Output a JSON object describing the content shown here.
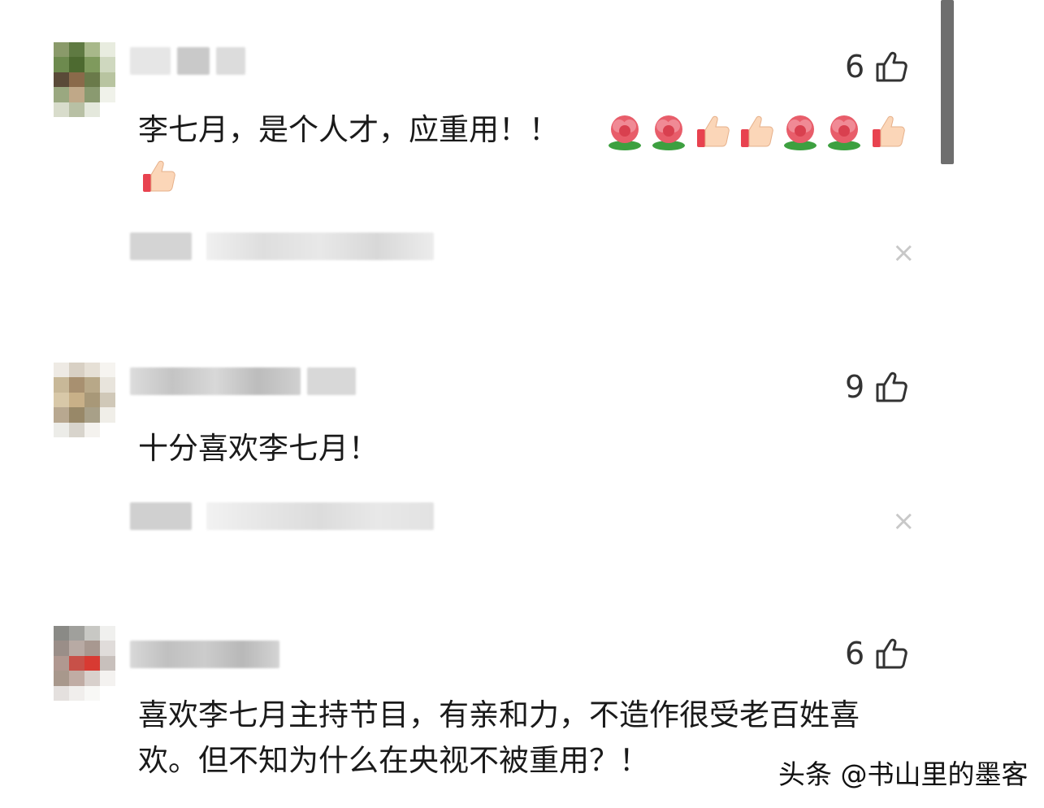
{
  "comments": [
    {
      "likes": "6",
      "text": "李七月，是个人才，应重用！！",
      "emojis": [
        "flower-emoji",
        "flower-emoji",
        "thumbs-up-emoji",
        "thumbs-up-emoji",
        "flower-emoji",
        "flower-emoji",
        "thumbs-up-emoji",
        "thumbs-up-emoji"
      ]
    },
    {
      "likes": "9",
      "text": "十分喜欢李七月！"
    },
    {
      "likes": "6",
      "text": "喜欢李七月主持节目，有亲和力，不造作很受老百姓喜欢。但不知为什么在央视不被重用？！"
    }
  ],
  "close_glyph": "×",
  "watermark": "头条 @书山里的墨客",
  "colors": {
    "text": "#1a1a1a",
    "like": "#333333",
    "close": "#c8c8c8",
    "scrollbar": "#6e6e6e"
  }
}
